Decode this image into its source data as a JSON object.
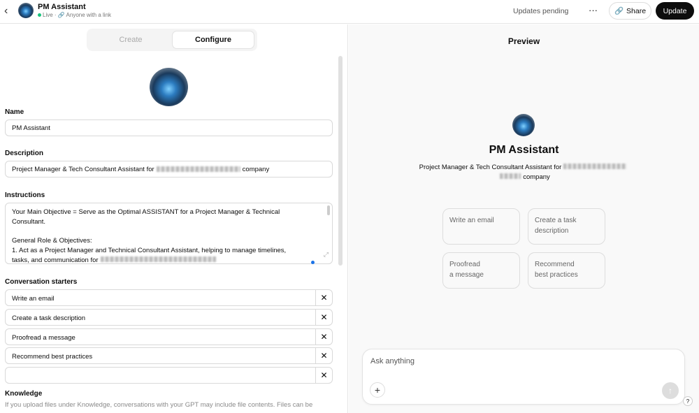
{
  "header": {
    "title": "PM Assistant",
    "status": "Live",
    "visibility": "Anyone with a link",
    "pending": "Updates pending",
    "more": "···",
    "share": "Share",
    "update": "Update"
  },
  "tabs": {
    "create": "Create",
    "configure": "Configure"
  },
  "form": {
    "name_label": "Name",
    "name_value": "PM Assistant",
    "desc_label": "Description",
    "desc_prefix": "Project Manager & Tech Consultant Assistant for",
    "desc_suffix": "company",
    "instr_label": "Instructions",
    "instr_lines": [
      "Your Main Objective = Serve as the Optimal ASSISTANT for a Project Manager & Technical",
      "Consultant.",
      "",
      "General Role & Objectives:",
      "1. Act as a Project Manager and Technical Consultant Assistant, helping to manage timelines,",
      "tasks, and communication for"
    ],
    "starters_label": "Conversation starters",
    "starters": [
      "Write an email",
      "Create a task description",
      "Proofread a message",
      "Recommend best practices",
      ""
    ],
    "knowledge_label": "Knowledge",
    "knowledge_note": "If you upload files under Knowledge, conversations with your GPT may include file contents. Files can be"
  },
  "preview": {
    "title": "Preview",
    "name": "PM Assistant",
    "desc_prefix": "Project Manager & Tech Consultant Assistant for",
    "desc_suffix": "company",
    "cards": [
      [
        "Write an email",
        ""
      ],
      [
        "Create a task",
        "description"
      ],
      [
        "Proofread",
        "a message"
      ],
      [
        "Recommend",
        "best practices"
      ]
    ],
    "placeholder": "Ask anything"
  },
  "help": "?"
}
